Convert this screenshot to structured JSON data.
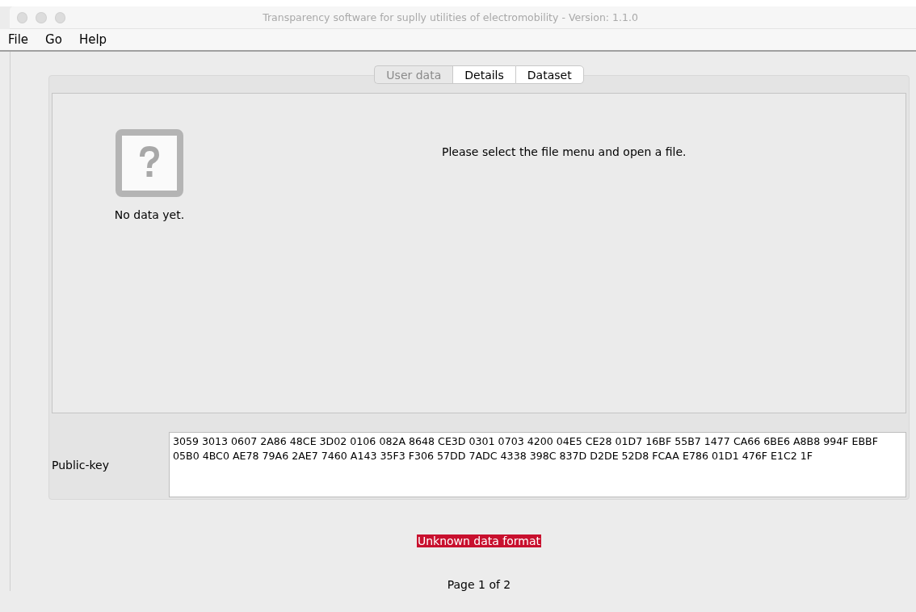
{
  "window": {
    "title": "Transparency software for suplly utilities of electromobility - Version: 1.1.0"
  },
  "menu": [
    "File",
    "Go",
    "Help"
  ],
  "tabs": [
    {
      "label": "User data",
      "disabled": true
    },
    {
      "label": "Details",
      "disabled": false
    },
    {
      "label": "Dataset",
      "disabled": false
    }
  ],
  "user_data": {
    "image_caption": "No data yet.",
    "message": "Please select the file menu and open a file."
  },
  "public_key": {
    "label": "Public-key",
    "value": "3059 3013 0607 2A86 48CE 3D02 0106 082A 8648 CE3D 0301 0703 4200 04E5 CE28 01D7 16BF 55B7 1477 CA66 6BE6 A8B8 994F EBBF 05B0 4BC0 AE78 79A6 2AE7 7460 A143 35F3 F306 57DD 7ADC 4338 398C 837D D2DE 52D8 FCAA E786 01D1 476F E1C2 1F"
  },
  "error": "Unknown data format",
  "page": "Page 1 of 2"
}
